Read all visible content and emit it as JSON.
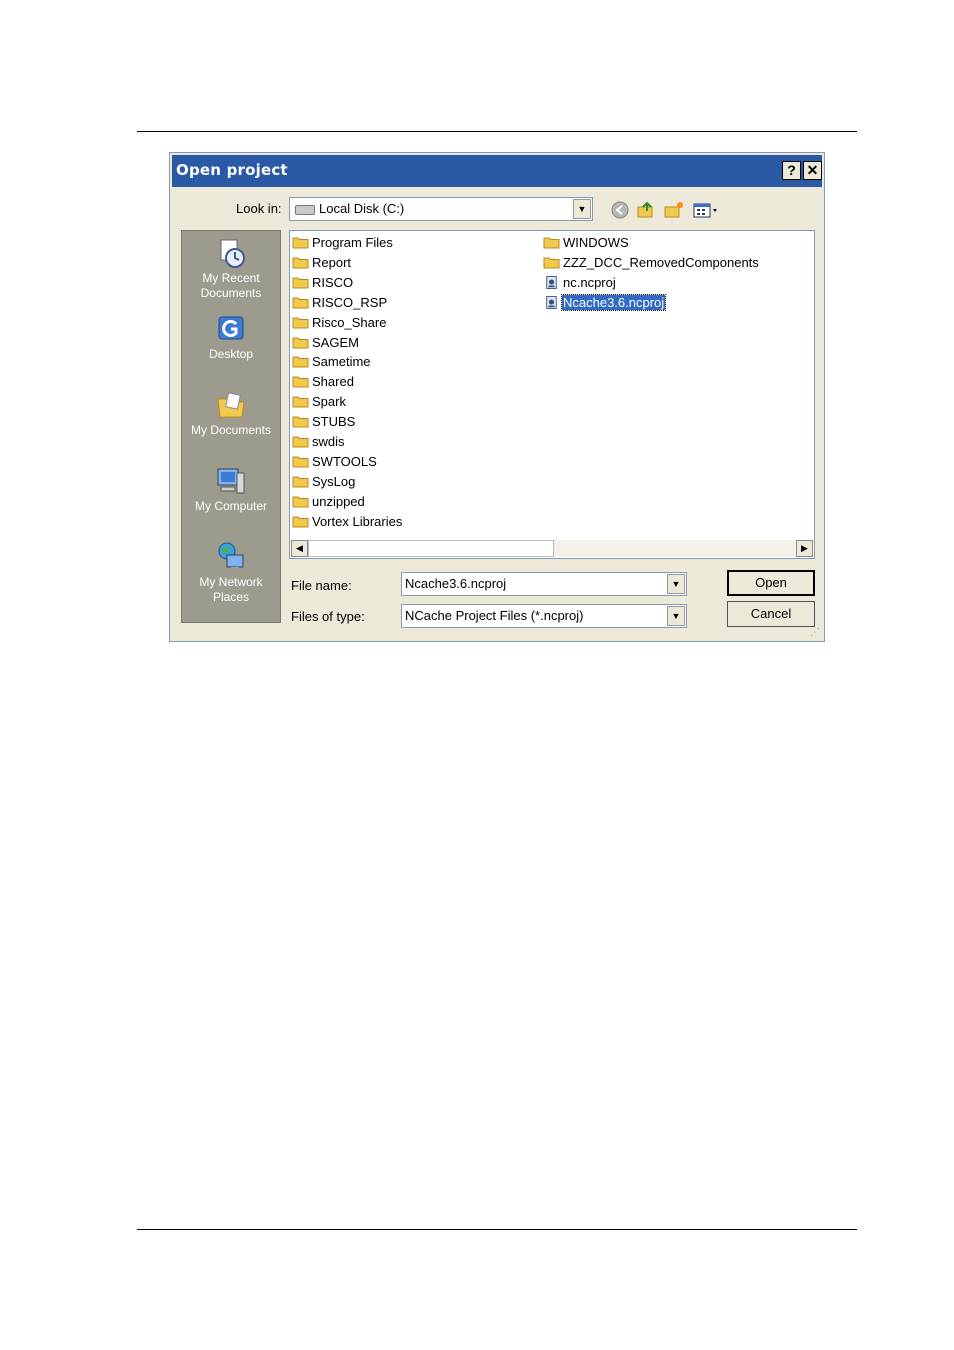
{
  "dialog": {
    "title": "Open project",
    "help_label": "?",
    "close_label": "✕"
  },
  "look_in": {
    "label": "Look in:",
    "value": "Local Disk (C:)"
  },
  "toolbar": {
    "icons": [
      "back-icon",
      "up-folder-icon",
      "new-folder-icon",
      "views-menu-icon"
    ]
  },
  "places": [
    {
      "label_line1": "My Recent",
      "label_line2": "Documents",
      "icon": "recent-documents-icon"
    },
    {
      "label_line1": "Desktop",
      "label_line2": "",
      "icon": "desktop-icon"
    },
    {
      "label_line1": "My Documents",
      "label_line2": "",
      "icon": "my-documents-icon"
    },
    {
      "label_line1": "My Computer",
      "label_line2": "",
      "icon": "my-computer-icon"
    },
    {
      "label_line1": "My Network",
      "label_line2": "Places",
      "icon": "network-places-icon"
    }
  ],
  "files": {
    "column1": [
      "Program Files",
      "Report",
      "RISCO",
      "RISCO_RSP",
      "Risco_Share",
      "SAGEM",
      "Sametime",
      "Shared",
      "Spark",
      "STUBS",
      "swdis",
      "SWTOOLS",
      "SysLog",
      "unzipped",
      "Vortex Libraries"
    ],
    "column2": [
      "WINDOWS",
      "ZZZ_DCC_RemovedComponents",
      "nc.ncproj",
      "Ncache3.6.ncproj"
    ],
    "selected": "Ncache3.6.ncproj"
  },
  "file_name": {
    "label": "File name:",
    "value": "Ncache3.6.ncproj"
  },
  "file_type": {
    "label": "Files of type:",
    "value": "NCache Project Files (*.ncproj)"
  },
  "buttons": {
    "open": "Open",
    "cancel": "Cancel"
  },
  "colors": {
    "titlebar": "#2a5aa6",
    "selection": "#316ac5",
    "dialog_bg": "#ece9d8",
    "places_bg": "#9c9b8d",
    "folder": "#f2c94c"
  }
}
